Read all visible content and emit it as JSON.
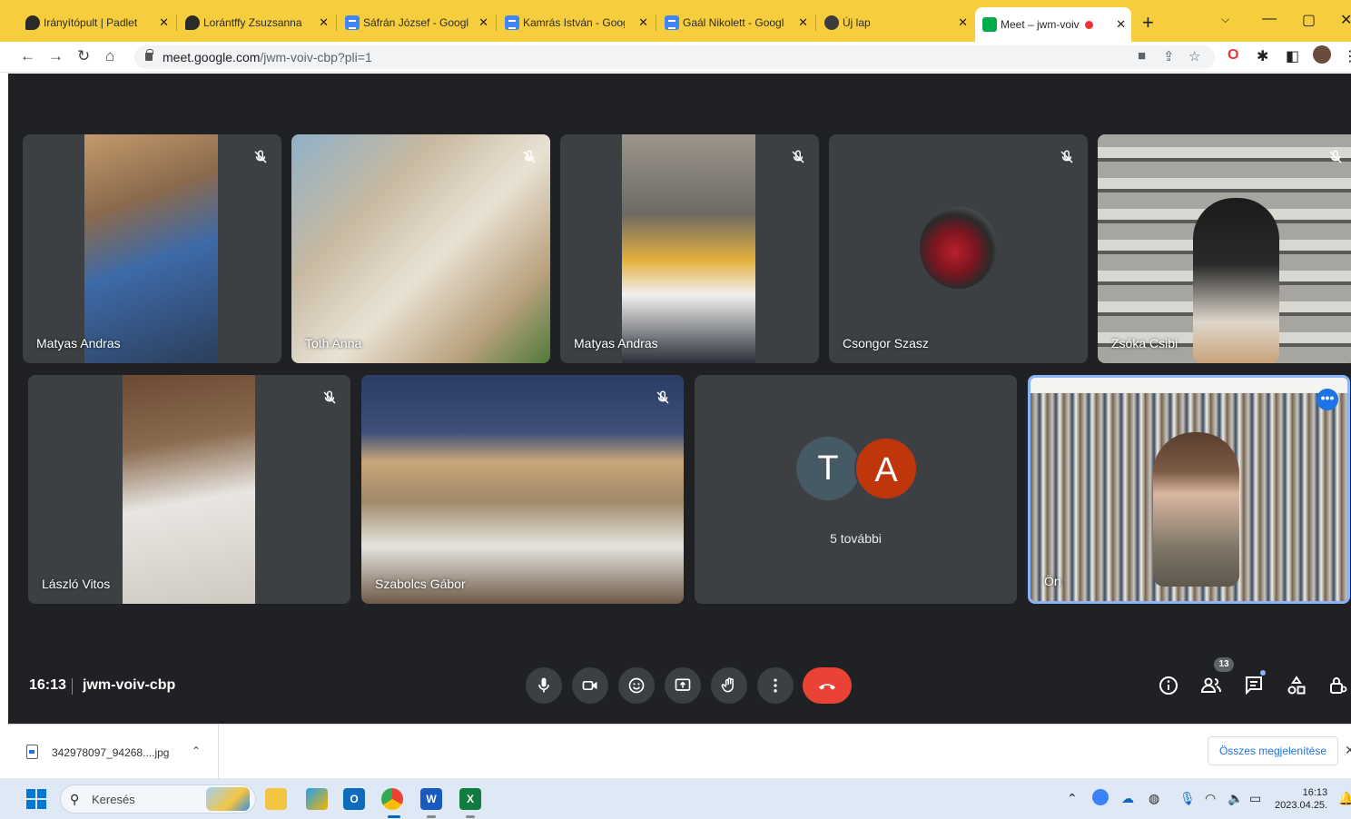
{
  "browser": {
    "tabs": [
      {
        "title": "Irányítópult | Padlet",
        "icon": "padlet-icon"
      },
      {
        "title": "Lorántffy Zsuzsanna",
        "icon": "padlet-icon"
      },
      {
        "title": "Sáfrán József - Googl",
        "icon": "docs-icon"
      },
      {
        "title": "Kamrás István - Goog",
        "icon": "docs-icon"
      },
      {
        "title": "Gaál Nikolett - Googl",
        "icon": "docs-icon"
      },
      {
        "title": "Új lap",
        "icon": "chrome-icon"
      },
      {
        "title": "Meet – jwm-voiv",
        "icon": "meet-icon"
      }
    ],
    "close_glyph": "✕",
    "new_tab_glyph": "+",
    "url_host": "meet.google.com",
    "url_path": "/jwm-voiv-cbp?pli=1"
  },
  "meet": {
    "participants": [
      {
        "name": "Matyas Andras",
        "muted": true
      },
      {
        "name": "Toth Anna",
        "muted": true
      },
      {
        "name": "Matyas Andras",
        "muted": true
      },
      {
        "name": "Csongor Szasz",
        "muted": true
      },
      {
        "name": "Zsóka Csibi",
        "muted": true
      },
      {
        "name": "László Vitos",
        "muted": true
      },
      {
        "name": "Szabolcs Gábor",
        "muted": true
      }
    ],
    "more_tile": {
      "letters": [
        "T",
        "A"
      ],
      "label": "5 további"
    },
    "self_label": "Ön",
    "time": "16:13",
    "meeting_code": "jwm-voiv-cbp",
    "participant_count": "13",
    "colors": {
      "end_call": "#ea4335",
      "accent": "#1a73e8",
      "self_border": "#8ab4f8"
    }
  },
  "downloads": {
    "file_name": "342978097_94268....jpg",
    "show_all": "Összes megjelenítése"
  },
  "taskbar": {
    "search_label": "Keresés",
    "clock_time": "16:13",
    "clock_date": "2023.04.25."
  }
}
